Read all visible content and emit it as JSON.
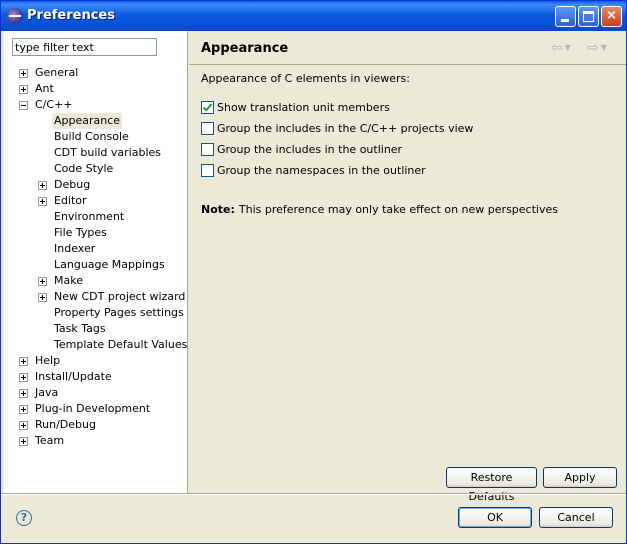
{
  "window": {
    "title": "Preferences"
  },
  "filter": {
    "value": "type filter text"
  },
  "tree": {
    "general": "General",
    "ant": "Ant",
    "cpp": "C/C++",
    "appearance": "Appearance",
    "build_console": "Build Console",
    "cdt_build_variables": "CDT build variables",
    "code_style": "Code Style",
    "debug": "Debug",
    "editor": "Editor",
    "environment": "Environment",
    "file_types": "File Types",
    "indexer": "Indexer",
    "language_mappings": "Language Mappings",
    "make": "Make",
    "new_cdt_project_wizard": "New CDT project wizard",
    "property_pages_settings": "Property Pages settings",
    "task_tags": "Task Tags",
    "template_default_values": "Template Default Values",
    "help": "Help",
    "install_update": "Install/Update",
    "java": "Java",
    "plugin_development": "Plug-in Development",
    "run_debug": "Run/Debug",
    "team": "Team"
  },
  "page": {
    "title": "Appearance",
    "description": "Appearance of C elements in viewers:",
    "options": [
      {
        "label": "Show translation unit members",
        "checked": true
      },
      {
        "label": "Group the includes in the C/C++ projects view",
        "checked": false
      },
      {
        "label": "Group the includes in the outliner",
        "checked": false
      },
      {
        "label": "Group the namespaces in the outliner",
        "checked": false
      }
    ],
    "note_label": "Note:",
    "note_text": "This preference may only take effect on new perspectives"
  },
  "buttons": {
    "restore_defaults": "Restore Defaults",
    "apply": "Apply",
    "ok": "OK",
    "cancel": "Cancel"
  },
  "icons": {
    "help": "?",
    "minimize": "minimize-icon",
    "maximize": "maximize-icon",
    "close": "×",
    "back": "⇦",
    "forward": "⇨",
    "dropdown": "▼"
  }
}
